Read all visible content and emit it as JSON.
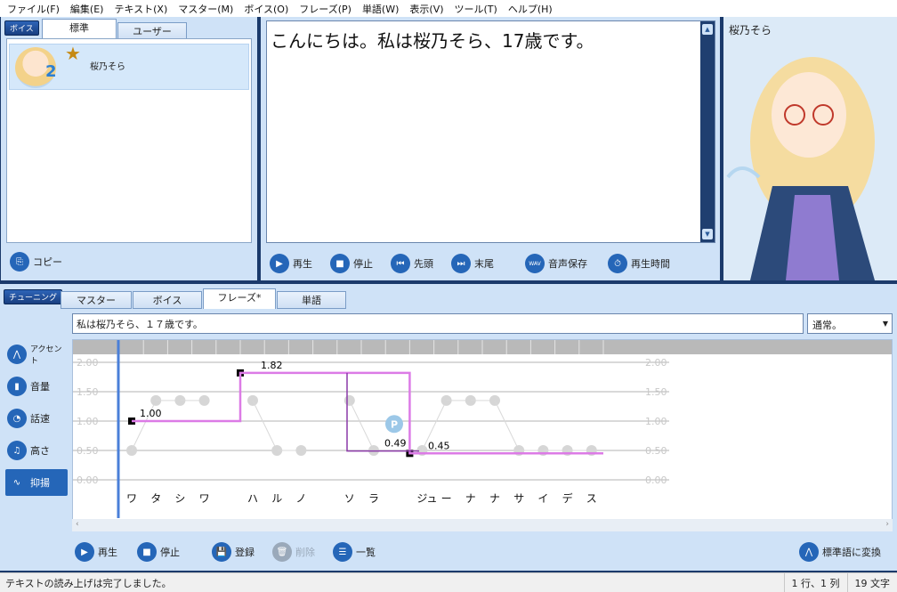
{
  "menu": [
    "ファイル(F)",
    "編集(E)",
    "テキスト(X)",
    "マスター(M)",
    "ボイス(O)",
    "フレーズ(P)",
    "単語(W)",
    "表示(V)",
    "ツール(T)",
    "ヘルプ(H)"
  ],
  "voice_panel": {
    "badge": "ボイス",
    "tabs": [
      "標準",
      "ユーザー"
    ],
    "item": {
      "name": "桜乃そら",
      "number": "2"
    },
    "copy_label": "コピー"
  },
  "text_panel": {
    "content": "こんにちは。私は桜乃そら、17歳です。",
    "buttons": {
      "play": "再生",
      "stop": "停止",
      "start": "先頭",
      "end": "末尾",
      "save": "音声保存",
      "time": "再生時間"
    },
    "wav": "WAV"
  },
  "image_panel": {
    "label": "桜乃そら"
  },
  "tuning": {
    "badge": "チューニング",
    "tabs": [
      "マスター",
      "ボイス",
      "フレーズ*",
      "単語"
    ],
    "phrase": "私は桜乃そら、１７歳です。",
    "mode": "通常。",
    "side": [
      "アクセント",
      "音量",
      "話速",
      "高さ",
      "抑揚"
    ],
    "p_marker": "P",
    "bottom": {
      "play": "再生",
      "stop": "停止",
      "register": "登録",
      "delete": "削除",
      "list": "一覧",
      "convert": "標準語に変換"
    }
  },
  "chart_data": {
    "type": "line",
    "y_ticks": [
      "2.00",
      "1.50",
      "1.00",
      "0.50",
      "0.00"
    ],
    "ylim": [
      0,
      2
    ],
    "kana": [
      "ワ",
      "タ",
      "シ",
      "ワ",
      "",
      "ハ",
      "ル",
      "ノ",
      "",
      "ソ",
      "ラ",
      "",
      "ジュ",
      "ー",
      "ナ",
      "ナ",
      "サ",
      "イ",
      "デ",
      "ス"
    ],
    "gray_points": [
      0.5,
      1.35,
      1.35,
      1.35,
      null,
      1.35,
      0.5,
      0.5,
      null,
      1.35,
      0.5,
      null,
      0.5,
      1.35,
      1.35,
      1.35,
      0.5,
      0.5,
      0.5,
      0.5
    ],
    "series": [
      {
        "segments": [
          {
            "from": 0,
            "to": 5,
            "value": 1.0
          },
          {
            "from": 5,
            "to": 12,
            "value": 1.82
          },
          {
            "from": 12,
            "to": 20,
            "value": 0.45
          }
        ]
      }
    ],
    "labels": [
      {
        "text": "1.00",
        "value": 1.0
      },
      {
        "text": "1.82",
        "value": 1.82
      },
      {
        "text": "0.49",
        "value": 0.49
      },
      {
        "text": "0.45",
        "value": 0.45
      }
    ]
  },
  "status": {
    "message": "テキストの読み上げは完了しました。",
    "position": "1 行、1 列",
    "count": "19 文字"
  }
}
